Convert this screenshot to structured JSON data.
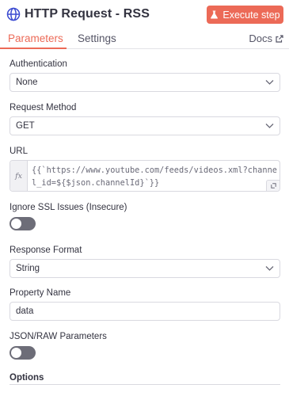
{
  "header": {
    "title": "HTTP Request - RSS",
    "execute_label": "Execute step"
  },
  "tabs": {
    "parameters": "Parameters",
    "settings": "Settings",
    "docs": "Docs"
  },
  "fields": {
    "authentication": {
      "label": "Authentication",
      "value": "None"
    },
    "request_method": {
      "label": "Request Method",
      "value": "GET"
    },
    "url": {
      "label": "URL",
      "fx": "fx",
      "value": "{{`https://www.youtube.com/feeds/videos.xml?channel_id=${$json.channelId}`}}"
    },
    "ignore_ssl": {
      "label": "Ignore SSL Issues (Insecure)",
      "enabled": false
    },
    "response_format": {
      "label": "Response Format",
      "value": "String"
    },
    "property_name": {
      "label": "Property Name",
      "value": "data"
    },
    "json_raw": {
      "label": "JSON/RAW Parameters",
      "enabled": false
    },
    "options": {
      "label": "Options"
    }
  },
  "colors": {
    "accent": "#ec6a57",
    "toggle_off": "#6d6d78",
    "border": "#d9d9e0"
  },
  "icons": {
    "header": "globe-icon",
    "execute": "flask-icon",
    "docs": "external-link-icon",
    "select": "chevron-down-icon",
    "url_expand": "expand-icon"
  }
}
